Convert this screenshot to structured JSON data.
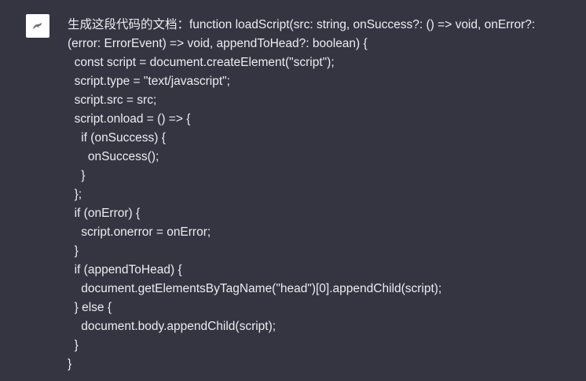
{
  "message": {
    "avatar_icon": "user-avatar-icon",
    "lines": [
      "生成这段代码的文档：function loadScript(src: string, onSuccess?: () => void, onError?:",
      "(error: ErrorEvent) => void, appendToHead?: boolean) {",
      "  const script = document.createElement(\"script\");",
      "  script.type = \"text/javascript\";",
      "  script.src = src;",
      "  script.onload = () => {",
      "    if (onSuccess) {",
      "      onSuccess();",
      "    }",
      "  };",
      "  if (onError) {",
      "    script.onerror = onError;",
      "  }",
      "  if (appendToHead) {",
      "    document.getElementsByTagName(\"head\")[0].appendChild(script);",
      "  } else {",
      "    document.body.appendChild(script);",
      "  }",
      "}"
    ]
  },
  "colors": {
    "background": "#343541",
    "text": "#ececf1",
    "avatar_bg": "#ffffff"
  }
}
